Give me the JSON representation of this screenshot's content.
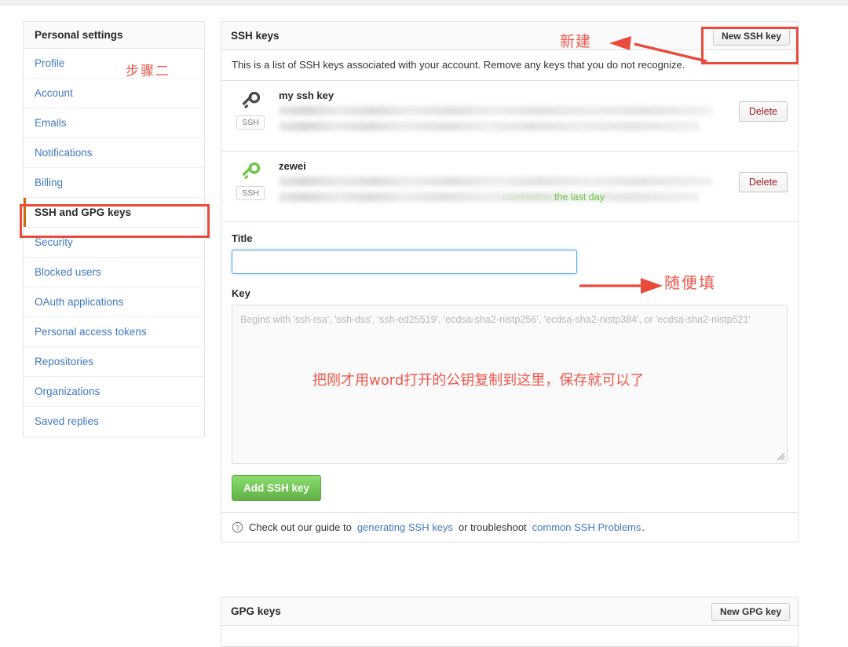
{
  "sidebar": {
    "header": "Personal settings",
    "items": [
      {
        "label": "Profile",
        "selected": false
      },
      {
        "label": "Account",
        "selected": false
      },
      {
        "label": "Emails",
        "selected": false
      },
      {
        "label": "Notifications",
        "selected": false
      },
      {
        "label": "Billing",
        "selected": false
      },
      {
        "label": "SSH and GPG keys",
        "selected": true
      },
      {
        "label": "Security",
        "selected": false
      },
      {
        "label": "Blocked users",
        "selected": false
      },
      {
        "label": "OAuth applications",
        "selected": false
      },
      {
        "label": "Personal access tokens",
        "selected": false
      },
      {
        "label": "Repositories",
        "selected": false
      },
      {
        "label": "Organizations",
        "selected": false
      },
      {
        "label": "Saved replies",
        "selected": false
      }
    ]
  },
  "ssh_panel": {
    "title": "SSH keys",
    "new_key_button": "New SSH key",
    "description": "This is a list of SSH keys associated with your account. Remove any keys that you do not recognize.",
    "keys": [
      {
        "name": "my ssh key",
        "badge": "SSH",
        "icon_color": "#4a4a4a",
        "fingerprint_redacted": true,
        "meta_text": "",
        "delete_label": "Delete"
      },
      {
        "name": "zewei",
        "badge": "SSH",
        "icon_color": "#6cc644",
        "fingerprint_redacted": true,
        "meta_text": "the last day",
        "meta_prefix": "used within",
        "delete_label": "Delete"
      }
    ],
    "form": {
      "title_label": "Title",
      "title_value": "",
      "title_placeholder": "",
      "key_label": "Key",
      "key_value": "",
      "key_placeholder": "Begins with 'ssh-rsa', 'ssh-dss', 'ssh-ed25519', 'ecdsa-sha2-nistp256', 'ecdsa-sha2-nistp384', or 'ecdsa-sha2-nistp521'",
      "submit_label": "Add SSH key"
    },
    "footer": {
      "icon": "question-circle-icon",
      "text_before": "Check out our guide to",
      "link1": "generating SSH keys",
      "text_middle": "or troubleshoot",
      "link2": "common SSH Problems",
      "text_after": "."
    }
  },
  "gpg_panel": {
    "title": "GPG keys",
    "new_key_button": "New GPG key"
  },
  "annotations": {
    "step_two": "步骤二",
    "new_label": "新建",
    "title_hint": "随便填",
    "key_hint": "把刚才用word打开的公钥复制到这里，保存就可以了",
    "color": "#f0564a",
    "box_color": "#ea4a3b"
  }
}
